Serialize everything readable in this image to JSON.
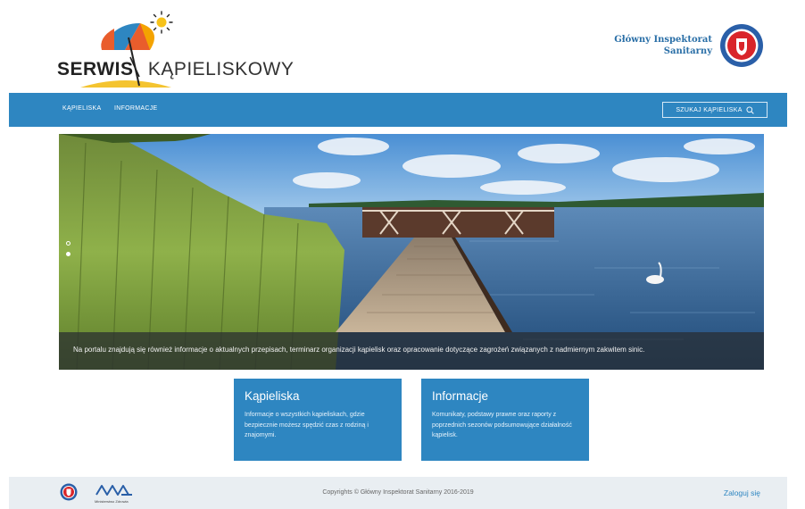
{
  "header": {
    "logo_bold": "SERWIS",
    "logo_light": "KĄPIELISKOWY",
    "gis_name": "Główny Inspektorat Sanitarny"
  },
  "nav": {
    "items": [
      {
        "label": "KĄPIELISKA"
      },
      {
        "label": "INFORMACJE"
      }
    ],
    "search_label": "SZUKAJ KĄPIELISKA"
  },
  "hero": {
    "caption": "Na portalu znajdują się również informacje o aktualnych przepisach, terminarz organizacji kąpielisk oraz opracowanie dotyczące zagrożeń związanych z nadmiernym zakwitem sinic.",
    "slides": 2,
    "active_slide": 2
  },
  "cards": [
    {
      "title": "Kąpieliska",
      "text": "Informacje o wszystkich kąpieliskach, gdzie bezpiecznie możesz spędzić czas z rodziną i znajomymi."
    },
    {
      "title": "Informacje",
      "text": "Komunikaty, podstawy prawne oraz raporty z poprzednich sezonów podsumowujące działalność kąpielisk."
    }
  ],
  "footer": {
    "ministry_label": "Ministerstwo Zdrowia",
    "copyright": "Copyrights © Główny Inspektorat Sanitarny 2016-2019",
    "login": "Zaloguj się"
  },
  "colors": {
    "brand_blue": "#2e86c1",
    "footer_bg": "#e9eef2",
    "gis_text": "#2a6fa7"
  },
  "icons": [
    "sun-icon",
    "umbrella-icon",
    "gis-emblem-icon",
    "search-icon",
    "ministry-logo-icon"
  ]
}
